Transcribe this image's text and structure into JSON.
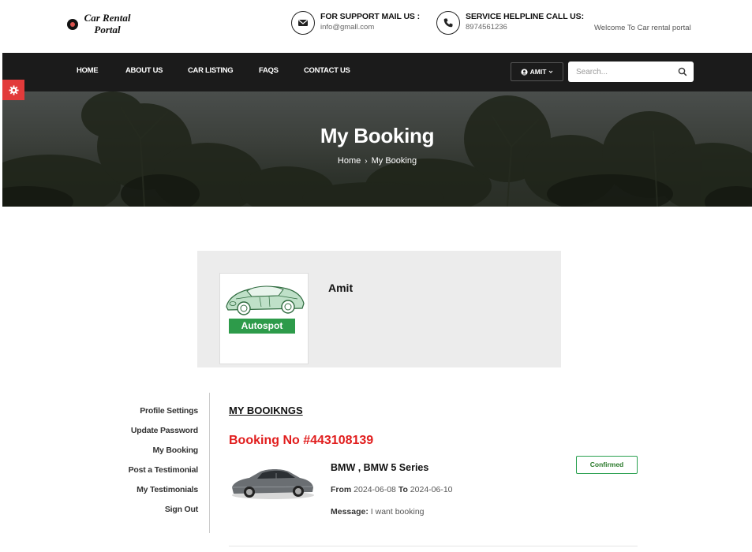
{
  "header": {
    "logo_line1": "Car Rental",
    "logo_line2": "Portal",
    "mail_title": "FOR SUPPORT MAIL US :",
    "mail_value": "info@gmall.com",
    "phone_title": "SERVICE HELPLINE CALL US:",
    "phone_value": "8974561236",
    "welcome": "Welcome To Car rental portal"
  },
  "nav": {
    "items": [
      "HOME",
      "ABOUT US",
      "CAR LISTING",
      "FAQS",
      "CONTACT US"
    ],
    "user_label": "AMIT",
    "search_placeholder": "Search..."
  },
  "banner": {
    "title": "My Booking",
    "breadcrumb": [
      "Home",
      "My Booking"
    ]
  },
  "profile": {
    "name": "Amit",
    "badge_text": "Autospot"
  },
  "sidebar": {
    "items": [
      "Profile Settings",
      "Update Password",
      "My Booking",
      "Post a Testimonial",
      "My Testimonials",
      "Sign Out"
    ]
  },
  "bookings": {
    "heading": "MY BOOIKNGS",
    "booking_no": "Booking No #443108139",
    "car_title": "BMW , BMW 5 Series",
    "from_label": "From",
    "from_date": "2024-06-08",
    "to_label": "To",
    "to_date": "2024-06-10",
    "message_label": "Message:",
    "message": "I want booking",
    "status": "Confirmed"
  },
  "colors": {
    "nav_bg": "#1b1b1b",
    "accent_red": "#e11d1d",
    "badge_green": "#2d9b4a",
    "status_border": "#2aa050"
  },
  "icons": {
    "mail": "envelope-icon",
    "phone": "phone-icon",
    "user": "user-circle-icon",
    "search": "search-icon",
    "settings": "gear-icon",
    "breadcrumb_sep": "chevron-right-icon"
  }
}
